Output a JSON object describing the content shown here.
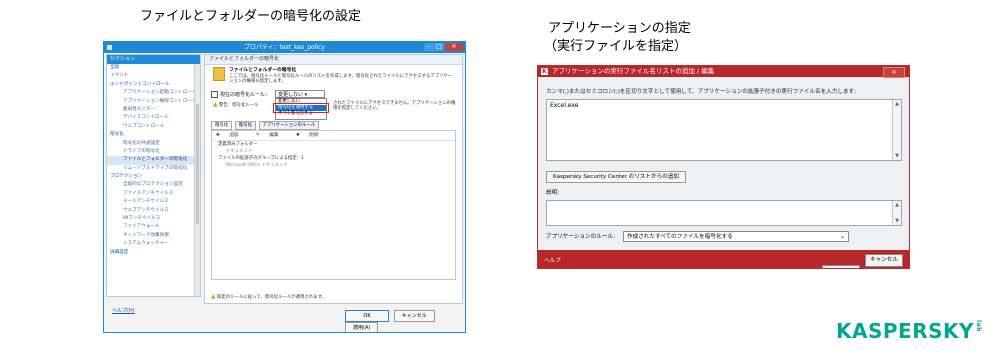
{
  "headings": {
    "left": "ファイルとフォルダーの暗号化の設定",
    "right_line1": "アプリケーションの指定",
    "right_line2": "（実行ファイルを指定）"
  },
  "policy_window": {
    "title": "プロパティ：test_kes_policy",
    "sidebar_header": "セクション",
    "sidebar_items": [
      {
        "label": "全般",
        "level": 0
      },
      {
        "label": "イベント",
        "level": 0
      },
      {
        "label": "エンドポイントコントロール",
        "level": 0
      },
      {
        "label": "アプリケーション起動コントロール",
        "level": 1
      },
      {
        "label": "アプリケーション権限コントロール",
        "level": 1
      },
      {
        "label": "脆弱性モニター",
        "level": 1
      },
      {
        "label": "デバイスコントロール",
        "level": 1
      },
      {
        "label": "ウェブコントロール",
        "level": 1
      },
      {
        "label": "暗号化",
        "level": 0
      },
      {
        "label": "暗号化の共通設定",
        "level": 1
      },
      {
        "label": "ドライブの暗号化",
        "level": 1
      },
      {
        "label": "ファイルとフォルダーの暗号化",
        "level": 1,
        "selected": true
      },
      {
        "label": "リムーバブルドライブの暗号化",
        "level": 1
      },
      {
        "label": "プロテクション",
        "level": 0
      },
      {
        "label": "全般的なプロテクション設定",
        "level": 1
      },
      {
        "label": "ファイルアンチウイルス",
        "level": 1
      },
      {
        "label": "メールアンチウイルス",
        "level": 1
      },
      {
        "label": "ウェブアンチウイルス",
        "level": 1
      },
      {
        "label": "IMアンチウイルス",
        "level": 1
      },
      {
        "label": "ファイアウォール",
        "level": 1
      },
      {
        "label": "ネットワーク攻撃防御",
        "level": 1
      },
      {
        "label": "システムウォッチャー",
        "level": 1
      },
      {
        "label": "詳細設定",
        "level": 0
      }
    ],
    "panel_header": "ファイルとフォルダーの暗号化",
    "panel_title": "ファイルとフォルダーの暗号化",
    "panel_desc": "ここでは、暗号化ルールと暗号化ルールのリストを作成します。暗号化されたファイルにアクセスするアプリケーションの権限も指定します。",
    "rule_label": "現在の暗号化ルール：",
    "rule_value": "変更しない",
    "dropdown_options": [
      "変更しない",
      "暗号化を適用する",
      "すべて復号化する"
    ],
    "warning_text": "警告：暗号化ルール",
    "warning_tail": "されたファイルにアクセスできません。アプリケーションの権限を指定してください。",
    "tabs": [
      "暗号化",
      "復号化",
      "アプリケーションのルール"
    ],
    "toolbar": {
      "add": "追加",
      "edit": "編集",
      "delete": "削除"
    },
    "tree": [
      {
        "label": "定義済みフォルダー",
        "sub": false
      },
      {
        "label": "ドキュメント",
        "sub": true
      },
      {
        "label": "ファイルの拡張子のグループによる指定：1",
        "sub": false
      },
      {
        "label": "Microsoft Office ドキュメント",
        "sub": true
      }
    ],
    "bottom_note": "既定のルールに従って、暗号化ルールが適用されます。",
    "help_link": "ヘルプ(H)",
    "buttons": {
      "ok": "OK",
      "cancel": "キャンセル",
      "apply": "適用(A)"
    }
  },
  "app_window": {
    "title": "アプリケーションの実行ファイル名リストの追加 / 編集",
    "instruction": "カンマ(,)またはセミコロン(;)を区切り文字として使用して、アプリケーションの拡張子付きの実行ファイル名を入力します:",
    "filename_value": "Excel.exe",
    "ksc_button": "Kaspersky Security Center のリストからの追加",
    "description_label": "説明:",
    "description_value": "",
    "rule_label": "アプリケーションのルール:",
    "rule_value": "作成されたすべてのファイルを暗号化する",
    "help": "ヘルプ",
    "ok": "OK",
    "cancel": "キャンセル(C)"
  },
  "logo": {
    "text": "KASPERSKY",
    "lab": "lab",
    "color": "#00a88e"
  },
  "colors": {
    "accent_blue": "#1e8ad6",
    "kaspersky_red": "#b8282a",
    "highlight_red": "#e02020"
  }
}
